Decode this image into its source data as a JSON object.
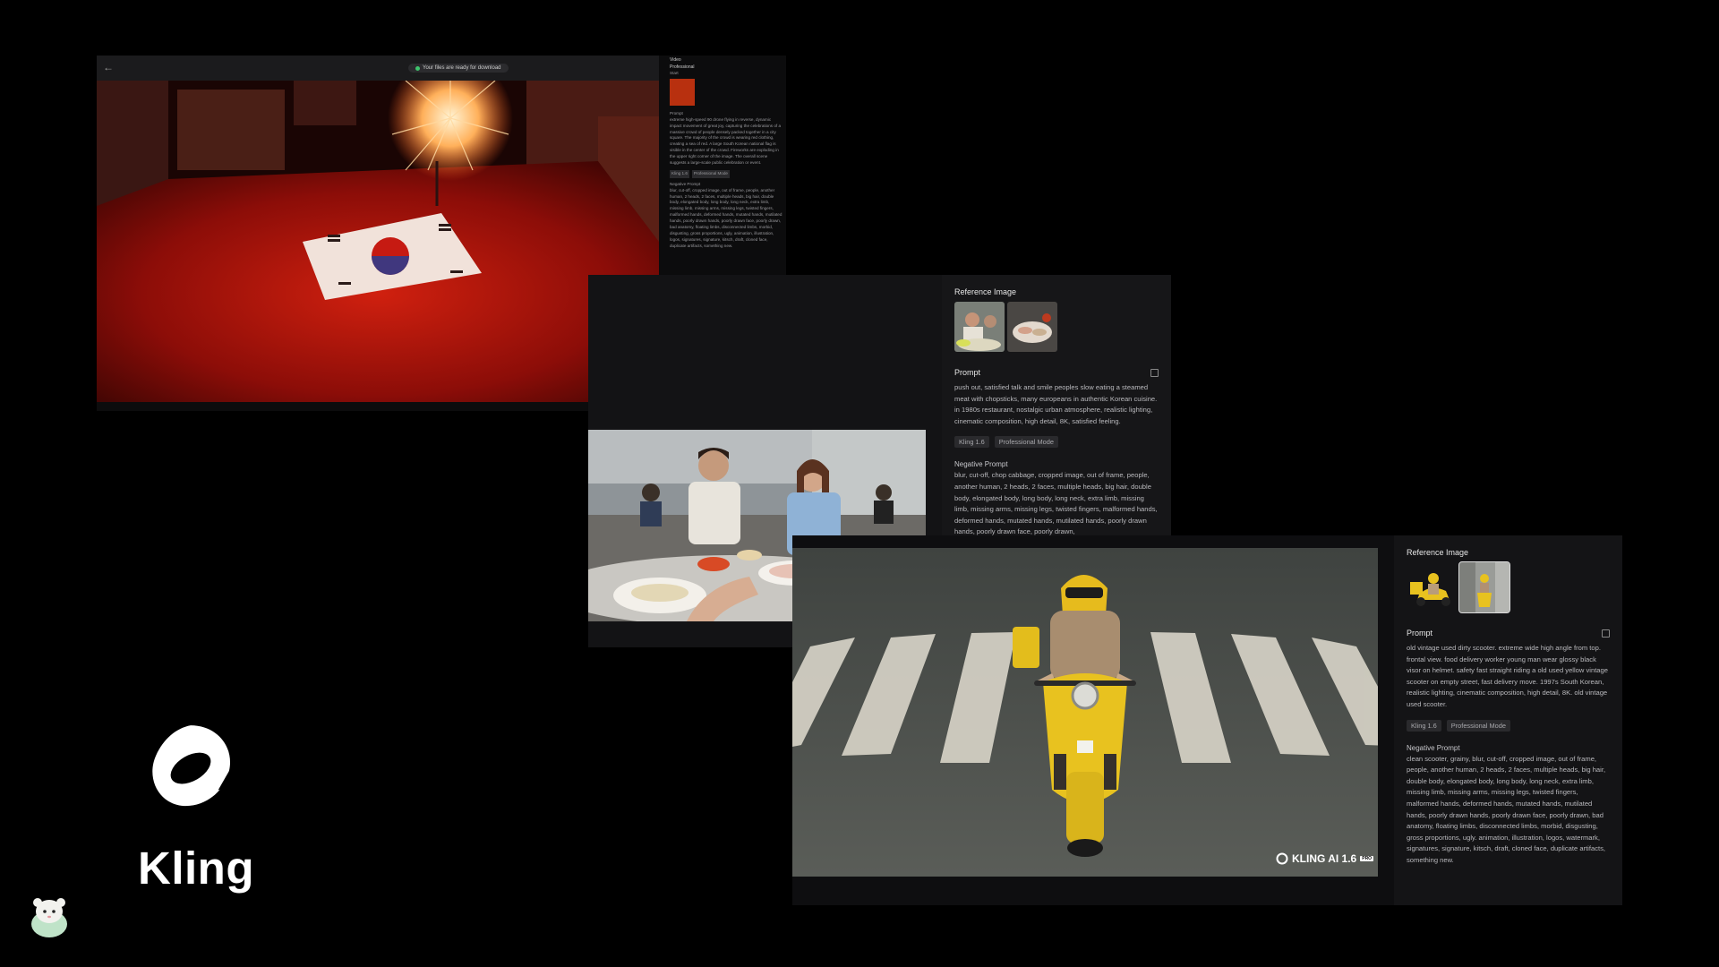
{
  "panel_fireworks": {
    "back_label": "←",
    "status_pill": "Your files are ready for download",
    "side": {
      "tab_video": "Video",
      "mode_title": "Professional",
      "start_label": "Start",
      "prompt_label": "Prompt",
      "prompt_text": "extreme high-speed 90 drone flying in reverse, dynamic impact movement of great joy, capturing the celebrations of a massive crowd of people densely packed together in a city square. The majority of the crowd is wearing red clothing, creating a sea of red. A large South Korean national flag is visible in the center of the crowd. Fireworks are exploding in the upper right corner of the image. The overall scene suggests a large-scale public celebration or event.",
      "tags": [
        "Kling 1.6",
        "Professional Mode"
      ],
      "negative_label": "Negative Prompt",
      "negative_text": "blur, cut-off, cropped image, out of frame, people, another human, 2 heads, 2 faces, multiple heads, big hair, double body, elongated body, long body, long neck, extra limb, missing limb, missing arms, missing legs, twisted fingers, malformed hands, deformed hands, mutated hands, mutilated hands, poorly drawn hands, poorly drawn face, poorly drawn, bad anatomy, floating limbs, disconnected limbs, morbid, disgusting, gross proportions, ugly, animation, illustration, logos, signatures, signature, kitsch, draft, cloned face, duplicate artifacts, something new."
    }
  },
  "panel_dining": {
    "reference_label": "Reference Image",
    "prompt_label": "Prompt",
    "prompt_text": "push out, satisfied talk and smile peoples slow eating a steamed meat with chopsticks, many europeans in authentic Korean cuisine. in 1980s restaurant, nostalgic urban atmosphere, realistic lighting, cinematic composition, high detail, 8K, satisfied feeling.",
    "tags": [
      "Kling 1.6",
      "Professional Mode"
    ],
    "negative_label": "Negative Prompt",
    "negative_text": "blur, cut-off, chop cabbage, cropped image, out of frame, people, another human, 2 heads, 2 faces, multiple heads, big hair, double body, elongated body, long body, long neck, extra limb, missing limb, missing arms, missing legs, twisted fingers, malformed hands, deformed hands, mutated hands, mutilated hands, poorly drawn hands, poorly drawn face, poorly drawn,"
  },
  "panel_scooter": {
    "reference_label": "Reference Image",
    "prompt_label": "Prompt",
    "prompt_text": "old vintage used dirty scooter. extreme wide high angle from top. frontal view. food delivery worker young man wear glossy black visor on helmet. safety fast straight riding a old used yellow vintage scooter on empty street, fast delivery move. 1997s South Korean, realistic lighting, cinematic composition, high detail, 8K. old vintage used scooter.",
    "tags": [
      "Kling 1.6",
      "Professional Mode"
    ],
    "negative_label": "Negative Prompt",
    "negative_text": "clean scooter, grainy, blur, cut-off, cropped image, out of frame, people, another human, 2 heads, 2 faces, multiple heads, big hair, double body, elongated body, long body, long neck, extra limb, missing limb, missing arms, missing legs, twisted fingers, malformed hands, deformed hands, mutated hands, mutilated hands, poorly drawn hands, poorly drawn face, poorly drawn, bad anatomy, floating limbs, disconnected limbs, morbid, disgusting, gross proportions, ugly. animation, illustration, logos, watermark, signatures, signature, kitsch, draft, cloned face, duplicate artifacts, something new.",
    "watermark_text": "KLING AI 1.6",
    "watermark_badge": "PRO"
  },
  "brand": {
    "name": "Kling"
  },
  "colors": {
    "background": "#000000",
    "panel": "#141416",
    "status_dot": "#3ec46d",
    "scooter_yellow": "#e8c21f",
    "crowd_red": "#b3110c"
  }
}
